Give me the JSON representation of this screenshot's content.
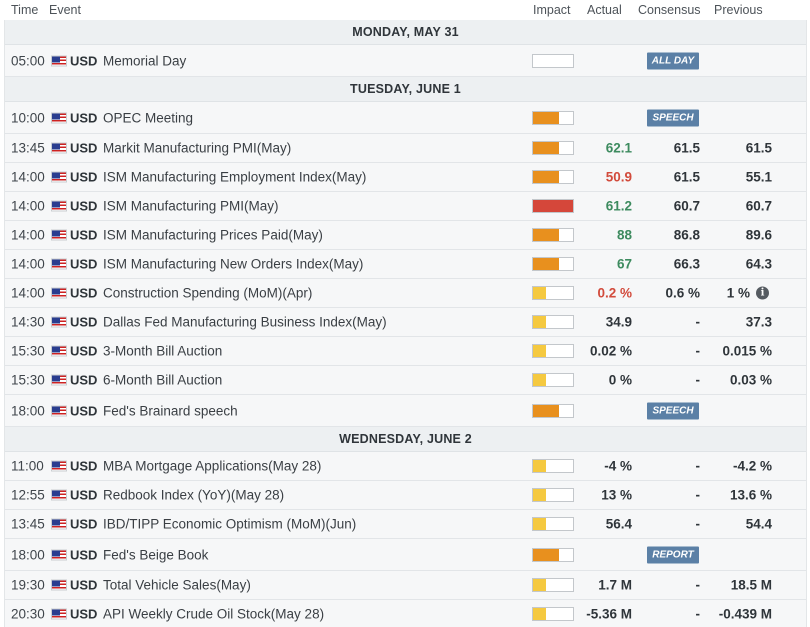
{
  "header": {
    "time": "Time",
    "event": "Event",
    "impact": "Impact",
    "actual": "Actual",
    "consensus": "Consensus",
    "previous": "Previous"
  },
  "colors": {
    "high": "#d5473a",
    "medium": "#e8901e",
    "low": "#f5c940",
    "tag": "#5b80a6",
    "green": "#3d8b5f",
    "red": "#d24b3c"
  },
  "days": [
    {
      "label": "MONDAY, MAY 31",
      "events": [
        {
          "time": "05:00",
          "currency": "USD",
          "name": "Memorial Day",
          "impact": "none",
          "tag": "ALL DAY",
          "actual": "",
          "consensus": "",
          "previous": ""
        }
      ]
    },
    {
      "label": "TUESDAY, JUNE 1",
      "events": [
        {
          "time": "10:00",
          "currency": "USD",
          "name": "OPEC Meeting",
          "impact": "medium",
          "tag": "SPEECH",
          "actual": "",
          "consensus": "",
          "previous": ""
        },
        {
          "time": "13:45",
          "currency": "USD",
          "name": "Markit Manufacturing PMI(May)",
          "impact": "medium",
          "actual": "62.1",
          "actual_color": "green",
          "consensus": "61.5",
          "previous": "61.5"
        },
        {
          "time": "14:00",
          "currency": "USD",
          "name": "ISM Manufacturing Employment Index(May)",
          "impact": "medium",
          "actual": "50.9",
          "actual_color": "red",
          "consensus": "61.5",
          "previous": "55.1"
        },
        {
          "time": "14:00",
          "currency": "USD",
          "name": "ISM Manufacturing PMI(May)",
          "impact": "high",
          "actual": "61.2",
          "actual_color": "green",
          "consensus": "60.7",
          "previous": "60.7"
        },
        {
          "time": "14:00",
          "currency": "USD",
          "name": "ISM Manufacturing Prices Paid(May)",
          "impact": "medium",
          "actual": "88",
          "actual_color": "green",
          "consensus": "86.8",
          "previous": "89.6"
        },
        {
          "time": "14:00",
          "currency": "USD",
          "name": "ISM Manufacturing New Orders Index(May)",
          "impact": "medium",
          "actual": "67",
          "actual_color": "green",
          "consensus": "66.3",
          "previous": "64.3"
        },
        {
          "time": "14:00",
          "currency": "USD",
          "name": "Construction Spending (MoM)(Apr)",
          "impact": "low",
          "actual": "0.2 %",
          "actual_color": "red",
          "consensus": "0.6 %",
          "previous": "1 %",
          "previous_info": "i"
        },
        {
          "time": "14:30",
          "currency": "USD",
          "name": "Dallas Fed Manufacturing Business Index(May)",
          "impact": "low",
          "actual": "34.9",
          "consensus": "-",
          "previous": "37.3"
        },
        {
          "time": "15:30",
          "currency": "USD",
          "name": "3-Month Bill Auction",
          "impact": "low",
          "actual": "0.02 %",
          "consensus": "-",
          "previous": "0.015 %"
        },
        {
          "time": "15:30",
          "currency": "USD",
          "name": "6-Month Bill Auction",
          "impact": "low",
          "actual": "0 %",
          "consensus": "-",
          "previous": "0.03 %"
        },
        {
          "time": "18:00",
          "currency": "USD",
          "name": "Fed's Brainard speech",
          "impact": "medium",
          "tag": "SPEECH",
          "actual": "",
          "consensus": "",
          "previous": ""
        }
      ]
    },
    {
      "label": "WEDNESDAY, JUNE 2",
      "events": [
        {
          "time": "11:00",
          "currency": "USD",
          "name": "MBA Mortgage Applications(May 28)",
          "impact": "low",
          "actual": "-4 %",
          "consensus": "-",
          "previous": "-4.2 %"
        },
        {
          "time": "12:55",
          "currency": "USD",
          "name": "Redbook Index (YoY)(May 28)",
          "impact": "low",
          "actual": "13 %",
          "consensus": "-",
          "previous": "13.6 %"
        },
        {
          "time": "13:45",
          "currency": "USD",
          "name": "IBD/TIPP Economic Optimism (MoM)(Jun)",
          "impact": "low",
          "actual": "56.4",
          "consensus": "-",
          "previous": "54.4"
        },
        {
          "time": "18:00",
          "currency": "USD",
          "name": "Fed's Beige Book",
          "impact": "medium",
          "tag": "REPORT",
          "actual": "",
          "consensus": "",
          "previous": ""
        },
        {
          "time": "19:30",
          "currency": "USD",
          "name": "Total Vehicle Sales(May)",
          "impact": "low",
          "actual": "1.7 M",
          "consensus": "-",
          "previous": "18.5 M"
        },
        {
          "time": "20:30",
          "currency": "USD",
          "name": "API Weekly Crude Oil Stock(May 28)",
          "impact": "low",
          "actual": "-5.36 M",
          "consensus": "-",
          "previous": "-0.439 M"
        }
      ]
    }
  ]
}
